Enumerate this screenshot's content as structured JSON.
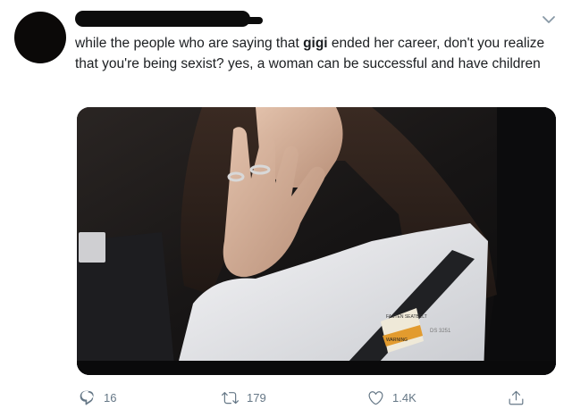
{
  "tweet": {
    "text_before": "while the people who are saying that ",
    "text_bold": "gigi",
    "text_after": " ended her career, don't you realize that  you're being sexist? yes, a woman can be successful and have children",
    "media": {
      "label_warning": "WARNING",
      "label_sticker": "FASTEN SEATBELT",
      "label_tag": "DS 3251"
    }
  },
  "actions": {
    "reply_count": "16",
    "retweet_count": "179",
    "like_count": "1.4K"
  },
  "icons": {
    "reply": "reply-icon",
    "retweet": "retweet-icon",
    "like": "heart-icon",
    "share": "share-icon",
    "menu": "chevron-down-icon"
  },
  "colors": {
    "icon_gray": "#657786",
    "text": "#14171a"
  }
}
